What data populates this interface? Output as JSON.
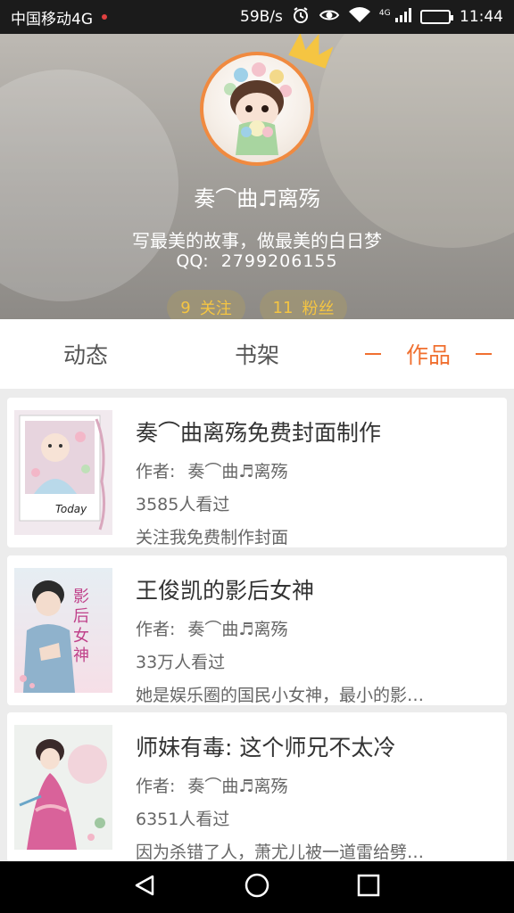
{
  "status_bar": {
    "carrier": "中国移动4G",
    "speed": "59B/s",
    "network": "4G",
    "time": "11:44",
    "battery_level": 0.85
  },
  "profile": {
    "username": "奏⌒曲♬离殇",
    "bio": "写最美的故事，做最美的白日梦",
    "qq_label": "QQ:",
    "qq_number": "2799206155",
    "following": {
      "count": "9",
      "label": "关注"
    },
    "fans": {
      "count": "11",
      "label": "粉丝"
    }
  },
  "tabs": [
    {
      "label": "动态",
      "active": false
    },
    {
      "label": "书架",
      "active": false
    },
    {
      "label": "作品",
      "active": true
    }
  ],
  "works": [
    {
      "title": "奏⌒曲离殇免费封面制作",
      "author_label": "作者:",
      "author": "奏⌒曲♬离殇",
      "views": "3585人看过",
      "description": "关注我免费制作封面",
      "cover_caption": "Today"
    },
    {
      "title": "王俊凯的影后女神",
      "author_label": "作者:",
      "author": "奏⌒曲♬离殇",
      "views": "33万人看过",
      "description": "她是娱乐圈的国民小女神，最小的影…",
      "cover_caption": "影后女神"
    },
    {
      "title": "师妹有毒: 这个师兄不太冷",
      "author_label": "作者:",
      "author": "奏⌒曲♬离殇",
      "views": "6351人看过",
      "description": "因为杀错了人，萧尤儿被一道雷给劈…",
      "cover_caption": ""
    }
  ],
  "colors": {
    "accent": "#f07030",
    "avatar_border": "#f08a40",
    "pill_text": "#f5c542"
  },
  "icons": {
    "alarm": "alarm-icon",
    "eye": "eye-icon",
    "wifi": "wifi-icon",
    "signal": "signal-icon",
    "battery": "battery-icon",
    "crown": "crown-icon",
    "back": "back-icon",
    "home": "home-icon",
    "recents": "recents-icon"
  }
}
